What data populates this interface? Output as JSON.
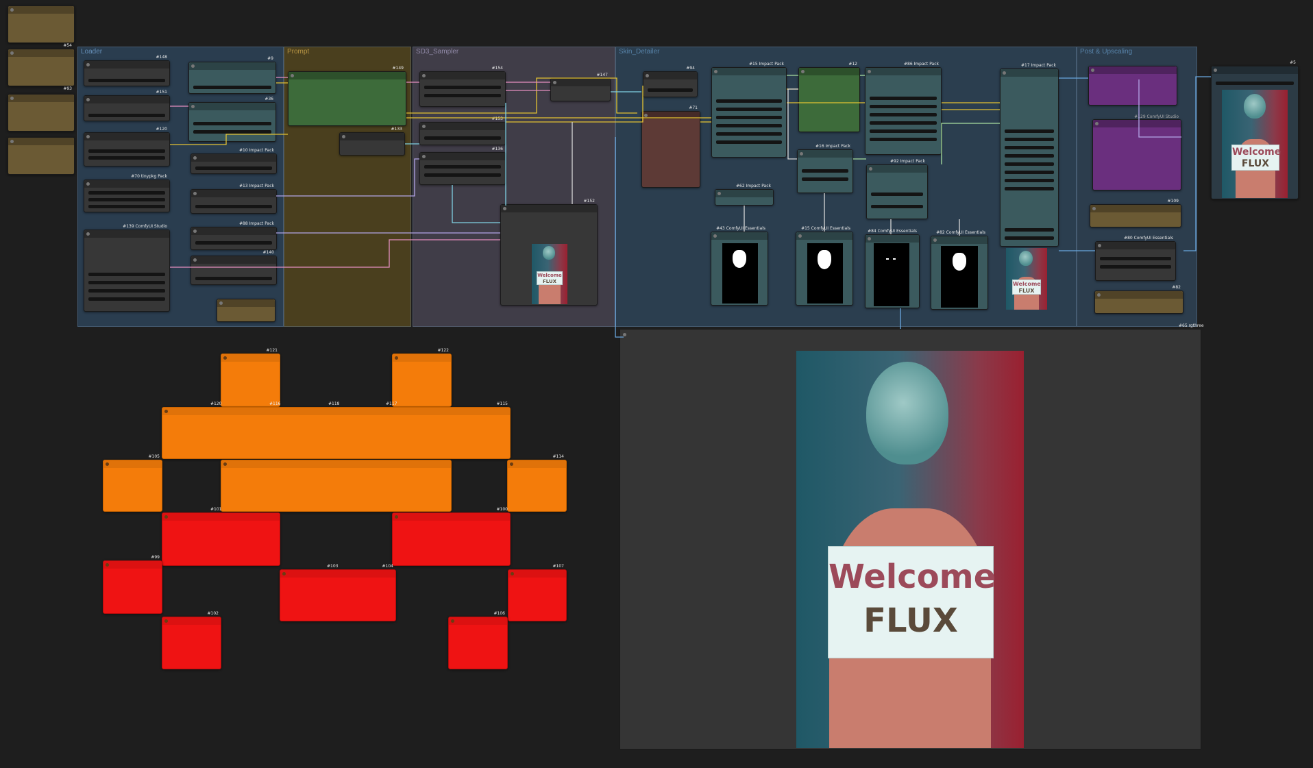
{
  "groups": {
    "loader": "Loader",
    "prompt": "Prompt",
    "sampler": "SD3_Sampler",
    "detailer": "Skin_Detailer",
    "upscaling": "Post & Upscaling"
  },
  "node_ids": {
    "n1": "#54",
    "n2": "#93",
    "n3": "#148",
    "n4": "#151",
    "n5": "#120",
    "n6": "#70 tinypkg Pack",
    "n7": "#139 ComfyUI Studio",
    "n8": "#9",
    "n9": "#36",
    "n10": "#10 Impact Pack",
    "n11": "#13 Impact Pack",
    "n12": "#88 Impact Pack",
    "n13": "#140",
    "n14": "#149",
    "n15": "#133",
    "n16": "#154",
    "n17": "#153",
    "n18": "#136",
    "n19": "#147",
    "n20": "#152",
    "n21": "#94",
    "n22": "#71",
    "n23": "#15 Impact Pack",
    "n24": "#12",
    "n25": "#86 Impact Pack",
    "n26": "#17 Impact Pack",
    "n27": "#16 Impact Pack",
    "n28": "#92 Impact Pack",
    "n29": "#62 Impact Pack",
    "n30": "#43 ComfyUI Essentials",
    "n31": "#15 ComfyUI Essentials",
    "n32": "#84 ComfyUI Essentials",
    "n33": "#82 ComfyUI Essentials",
    "n34": "#109",
    "n35": "#80 ComfyUI Essentials",
    "n36": "#82",
    "n37": "#65 rgthree",
    "n38": "#5",
    "o1": "#121",
    "o2": "#122",
    "o3": "#120",
    "o4": "#116",
    "o5": "#118",
    "o6": "#117",
    "o7": "#115",
    "o8": "#105",
    "o9": "#114",
    "r1": "#101",
    "r2": "#100",
    "r3": "#99",
    "r4": "#103",
    "r5": "#104",
    "r6": "#107",
    "r7": "#102",
    "r8": "#106",
    "x1": "#129 ComfyUI Studio"
  },
  "image_sign": {
    "line1": "Welcome",
    "line2": "FLUX"
  },
  "colors": {
    "wire_yellow": "#e3c233",
    "wire_pink": "#e58fc0",
    "wire_cyan": "#7fd1e3",
    "wire_lavender": "#b4a6e8",
    "wire_blue": "#6aa8e0",
    "wire_green": "#a9e0a0",
    "node_orange": "#f47c0a",
    "node_red": "#ef1313"
  }
}
